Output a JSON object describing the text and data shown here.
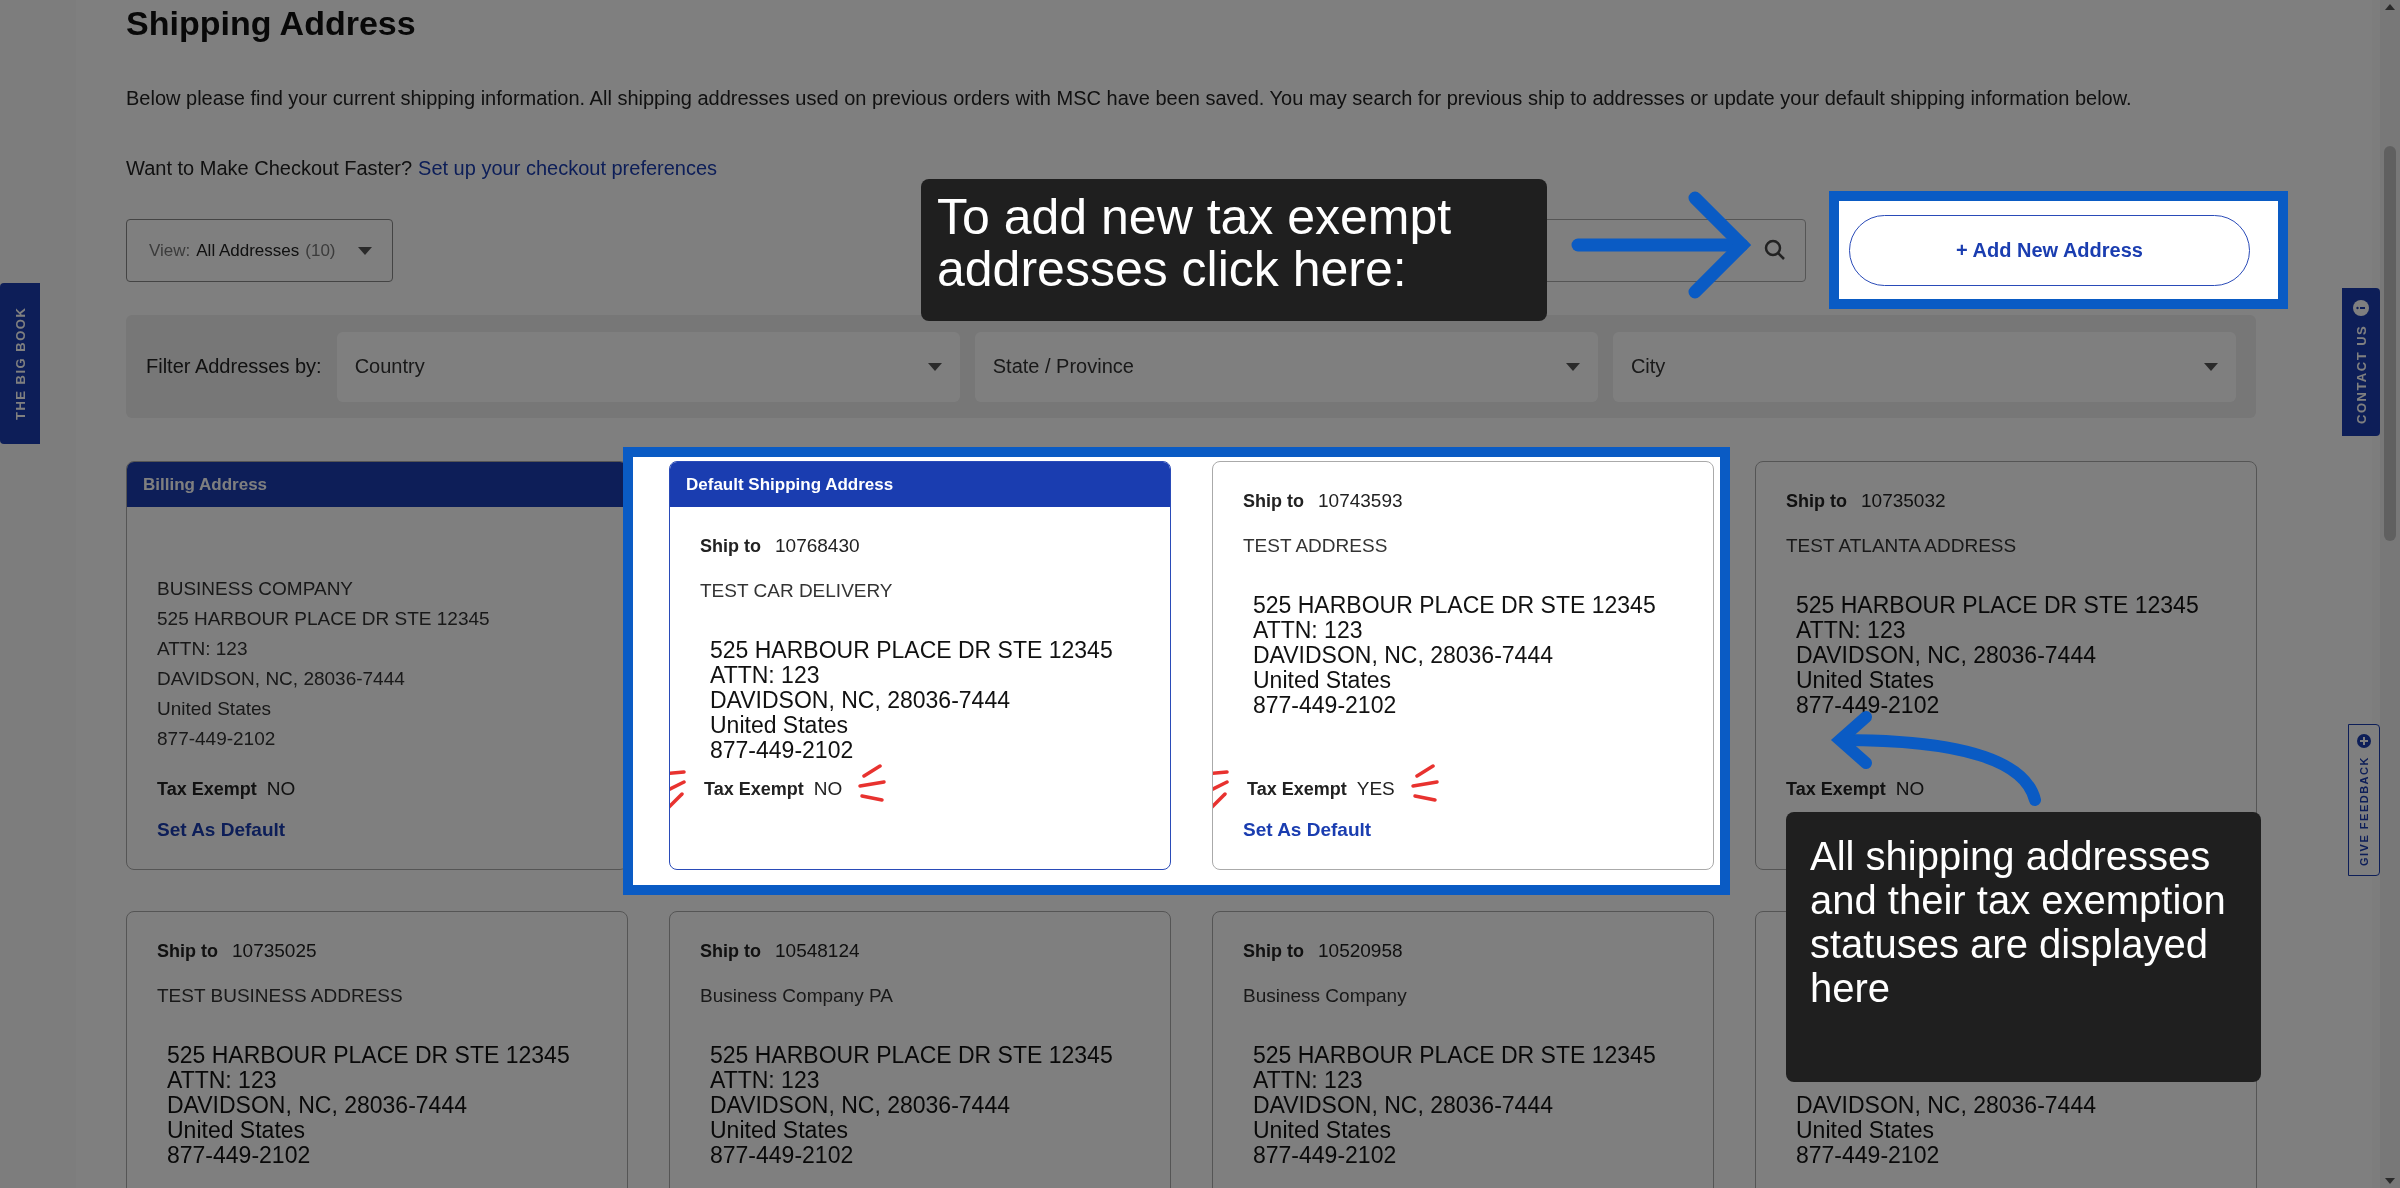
{
  "page_title": "Shipping Address",
  "intro": "Below please find your current shipping information. All shipping addresses used on previous orders with MSC have been saved. You may search for previous ship to addresses or update your default shipping information below.",
  "checkout_prompt": {
    "question": "Want to Make Checkout Faster?",
    "link": "Set up your checkout preferences"
  },
  "view_dropdown": {
    "label": "View:",
    "value": "All Addresses",
    "count": "(10)"
  },
  "add_button": "+ Add New Address",
  "filters": {
    "label": "Filter Addresses by:",
    "selects": [
      "Country",
      "State / Province",
      "City"
    ]
  },
  "cards": [
    {
      "kind": "billing",
      "header": "Billing Address",
      "lines": [
        "BUSINESS COMPANY",
        "525 HARBOUR PLACE DR STE 12345",
        "ATTN: 123",
        "DAVIDSON, NC, 28036-7444",
        "United States",
        "877-449-2102"
      ],
      "tax_label": "Tax Exempt",
      "tax_value": "NO",
      "action": "Set As Default",
      "emphasized": false
    },
    {
      "kind": "default",
      "header": "Default Shipping Address",
      "ship_label": "Ship to",
      "ship_number": "10768430",
      "name": "TEST CAR DELIVERY",
      "lines": [
        "525 HARBOUR PLACE DR STE 12345",
        "ATTN: 123",
        "DAVIDSON, NC, 28036-7444",
        "United States",
        "877-449-2102"
      ],
      "tax_label": "Tax Exempt",
      "tax_value": "NO",
      "emphasized": true
    },
    {
      "kind": "address",
      "ship_label": "Ship to",
      "ship_number": "10743593",
      "name": "TEST ADDRESS",
      "lines": [
        "525 HARBOUR PLACE DR STE 12345",
        "ATTN: 123",
        "DAVIDSON, NC, 28036-7444",
        "United States",
        "877-449-2102"
      ],
      "tax_label": "Tax Exempt",
      "tax_value": "YES",
      "action": "Set As Default",
      "emphasized": true
    },
    {
      "kind": "address",
      "ship_label": "Ship to",
      "ship_number": "10735032",
      "name": "TEST ATLANTA ADDRESS",
      "lines": [
        "525 HARBOUR PLACE DR STE 12345",
        "ATTN: 123",
        "DAVIDSON, NC, 28036-7444",
        "United States",
        "877-449-2102"
      ],
      "tax_label": "Tax Exempt",
      "tax_value": "NO",
      "emphasized": false
    },
    {
      "kind": "address",
      "ship_label": "Ship to",
      "ship_number": "10735025",
      "name": "TEST BUSINESS ADDRESS",
      "lines": [
        "525 HARBOUR PLACE DR STE 12345",
        "ATTN: 123",
        "DAVIDSON, NC, 28036-7444",
        "United States",
        "877-449-2102"
      ]
    },
    {
      "kind": "address",
      "ship_label": "Ship to",
      "ship_number": "10548124",
      "name": "Business Company PA",
      "lines": [
        "525 HARBOUR PLACE DR STE 12345",
        "ATTN: 123",
        "DAVIDSON, NC, 28036-7444",
        "United States",
        "877-449-2102"
      ]
    },
    {
      "kind": "address",
      "ship_label": "Ship to",
      "ship_number": "10520958",
      "name": "Business Company",
      "lines": [
        "525 HARBOUR PLACE DR STE 12345",
        "ATTN: 123",
        "DAVIDSON, NC, 28036-7444",
        "United States",
        "877-449-2102"
      ]
    },
    {
      "kind": "address",
      "lines": [
        "DAVIDSON, NC, 28036-7444",
        "United States",
        "877-449-2102"
      ]
    }
  ],
  "side_tabs": {
    "left": "THE BIG BOOK",
    "contact": "CONTACT US",
    "feedback": "GIVE FEEDBACK"
  },
  "annotations": [
    {
      "kind": "callout",
      "text": "To add new tax exempt addresses click here:"
    },
    {
      "kind": "callout",
      "text": "All shipping addresses and their tax exemption statuses are displayed here"
    }
  ]
}
